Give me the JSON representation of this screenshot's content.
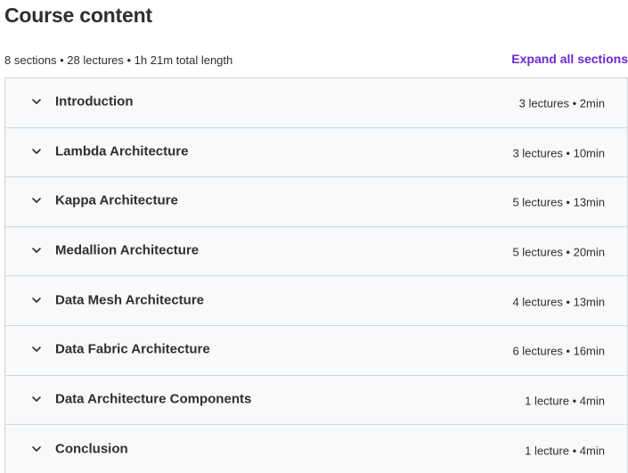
{
  "header": {
    "title": "Course content"
  },
  "summary": {
    "text": "8 sections • 28 lectures • 1h 21m total length",
    "expand_label": "Expand all sections"
  },
  "colors": {
    "accent": "#6d28d2",
    "section_background": "#f7f9fa",
    "border": "#d1d7dc",
    "text": "#2d2f31"
  },
  "sections": [
    {
      "title": "Introduction",
      "meta": "3 lectures • 2min",
      "icon": "chevron-down-icon"
    },
    {
      "title": "Lambda Architecture",
      "meta": "3 lectures • 10min",
      "icon": "chevron-down-icon"
    },
    {
      "title": "Kappa Architecture",
      "meta": "5 lectures • 13min",
      "icon": "chevron-down-icon"
    },
    {
      "title": "Medallion Architecture",
      "meta": "5 lectures • 20min",
      "icon": "chevron-down-icon"
    },
    {
      "title": "Data Mesh Architecture",
      "meta": "4 lectures • 13min",
      "icon": "chevron-down-icon"
    },
    {
      "title": "Data Fabric Architecture",
      "meta": "6 lectures • 16min",
      "icon": "chevron-down-icon"
    },
    {
      "title": "Data Architecture Components",
      "meta": "1 lecture • 4min",
      "icon": "chevron-down-icon"
    },
    {
      "title": "Conclusion",
      "meta": "1 lecture • 4min",
      "icon": "chevron-down-icon"
    }
  ]
}
